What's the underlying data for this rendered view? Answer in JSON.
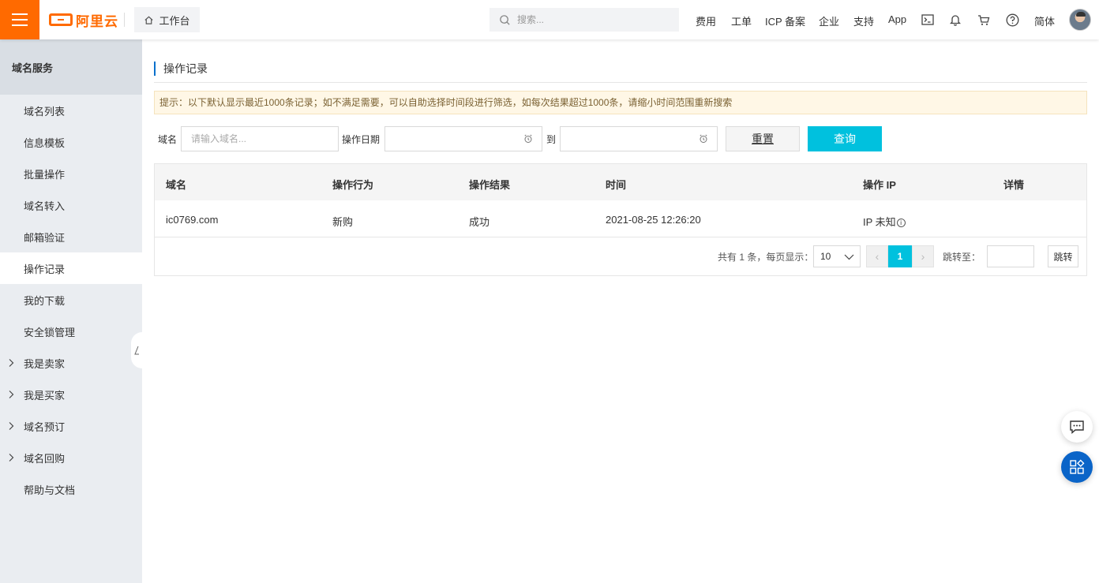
{
  "header": {
    "logo_text": "阿里云",
    "workbench_label": "工作台",
    "search_placeholder": "搜索...",
    "links": {
      "fee": "费用",
      "ticket": "工单",
      "icp": "ICP 备案",
      "enterprise": "企业",
      "support": "支持",
      "app": "App",
      "language": "简体"
    },
    "icons": [
      "terminal-icon",
      "bell-icon",
      "cart-icon",
      "help-icon"
    ]
  },
  "sidebar": {
    "title": "域名服务",
    "items": [
      {
        "label": "域名列表",
        "expandable": false
      },
      {
        "label": "信息模板",
        "expandable": false
      },
      {
        "label": "批量操作",
        "expandable": false
      },
      {
        "label": "域名转入",
        "expandable": false
      },
      {
        "label": "邮箱验证",
        "expandable": false
      },
      {
        "label": "操作记录",
        "expandable": false,
        "active": true
      },
      {
        "label": "我的下载",
        "expandable": false
      },
      {
        "label": "安全锁管理",
        "expandable": false
      },
      {
        "label": "我是卖家",
        "expandable": true
      },
      {
        "label": "我是买家",
        "expandable": true
      },
      {
        "label": "域名预订",
        "expandable": true
      },
      {
        "label": "域名回购",
        "expandable": true
      },
      {
        "label": "帮助与文档",
        "expandable": false
      }
    ]
  },
  "main": {
    "title": "操作记录",
    "notice": "提示：以下默认显示最近1000条记录；如不满足需要，可以自助选择时间段进行筛选，如每次结果超过1000条，请缩小时间范围重新搜索",
    "filters": {
      "domain_label": "域名",
      "domain_placeholder": "请输入域名...",
      "date_label": "操作日期",
      "to_label": "到",
      "start_date_value": "",
      "end_date_value": "",
      "reset_label": "重置",
      "query_label": "查询"
    },
    "table": {
      "columns": [
        "域名",
        "操作行为",
        "操作结果",
        "时间",
        "操作 IP",
        "详情"
      ],
      "rows": [
        {
          "domain": "ic0769.com",
          "action": "新购",
          "result": "成功",
          "time": "2021-08-25 12:26:20",
          "ip": "IP 未知",
          "detail": ""
        }
      ]
    },
    "pagination": {
      "summary": "共有 1 条，每页显示：",
      "page_size": "10",
      "prev": "‹",
      "current_page": "1",
      "next": "›",
      "jump_label": "跳转至：",
      "jump_value": "",
      "jump_button": "跳转"
    }
  },
  "colors": {
    "brand": "#ff6a00",
    "accent": "#00c1de",
    "float_button": "#0a64c8"
  }
}
